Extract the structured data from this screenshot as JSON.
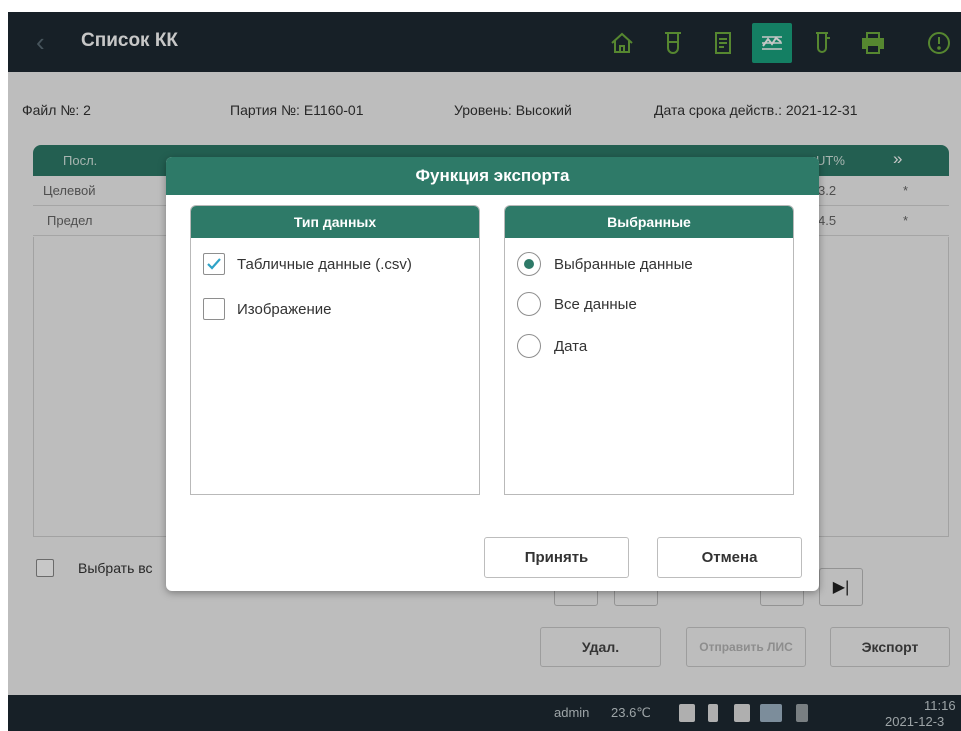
{
  "header": {
    "back_glyph": "‹",
    "title": "Список КК",
    "icons": [
      "home-icon",
      "test-tube-icon",
      "document-icon",
      "qc-chart-icon",
      "test-tube-alt-icon",
      "printer-icon",
      "alert-icon"
    ],
    "active_icon": "qc-chart-icon"
  },
  "info": {
    "file": "Файл №: 2",
    "lot": "Партия №: E1160-01",
    "level": "Уровень: Высокий",
    "expiry": "Дата срока действ.: 2021-12-31"
  },
  "table": {
    "headers": [
      "Посл.",
      "UT%",
      "»"
    ],
    "rows": [
      {
        "label": "Целевой",
        "value": "3.2",
        "flag": "*"
      },
      {
        "label": "Предел",
        "value": "4.5",
        "flag": "*"
      }
    ]
  },
  "select_all_label": "Выбрать вс",
  "nav": {
    "last_glyph": "▶|"
  },
  "actions": {
    "delete": "Удал.",
    "send_lis": "Отправить ЛИС",
    "export": "Экспорт"
  },
  "status": {
    "user": "admin",
    "temperature": "23.6℃",
    "time": "11:16",
    "date": "2021-12-3"
  },
  "dialog": {
    "title": "Функция экспорта",
    "data_type": {
      "title": "Тип данных",
      "options": [
        {
          "label": "Табличные данные (.csv)",
          "checked": true
        },
        {
          "label": "Изображение",
          "checked": false
        }
      ]
    },
    "selected": {
      "title": "Выбранные",
      "options": [
        {
          "label": "Выбранные данные",
          "selected": true
        },
        {
          "label": "Все данные",
          "selected": false
        },
        {
          "label": "Дата",
          "selected": false
        }
      ]
    },
    "accept": "Принять",
    "cancel": "Отмена"
  },
  "colors": {
    "accent": "#2e7a68",
    "active_icon_bg": "#1aa37f",
    "topbar": "#1e2a32"
  }
}
